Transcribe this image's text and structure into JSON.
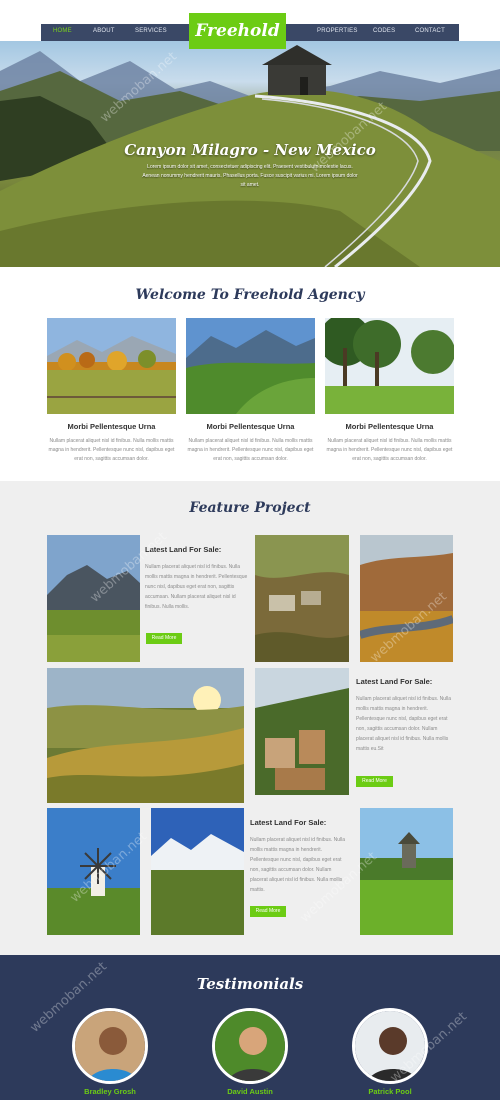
{
  "nav": {
    "left": [
      "HOME",
      "ABOUT",
      "SERVICES"
    ],
    "right": [
      "PROPERTIES",
      "CODES",
      "CONTACT"
    ],
    "logo": "Freehold",
    "colors": {
      "bar": "#3a4866",
      "accent": "#6ccc14"
    }
  },
  "hero": {
    "title": "Canyon Milagro - New Mexico",
    "text": "Lorem ipsum dolor sit amet, consectetuer adipiscing elit. Praesent vestibulum molestie lacus. Aenean nonummy hendrerit mauris. Phasellus porta. Fusce suscipit varius mi. Lorem ipsum dolor sit amet."
  },
  "welcome": {
    "title": "Welcome To Freehold Agency",
    "cards": [
      {
        "title": "Morbi Pellentesque Urna",
        "text": "Nullam placerat aliquet nisl id finibus. Nulla mollis mattis magna in hendrerit. Pellentesque nunc nisl, dapibus eget erat non, sagittis accumsan dolor."
      },
      {
        "title": "Morbi Pellentesque Urna",
        "text": "Nullam placerat aliquet nisl id finibus. Nulla mollis mattis magna in hendrerit. Pellentesque nunc nisl, dapibus eget erat non, sagittis accumsan dolor."
      },
      {
        "title": "Morbi Pellentesque Urna",
        "text": "Nullam placerat aliquet nisl id finibus. Nulla mollis mattis magna in hendrerit. Pellentesque nunc nisl, dapibus eget erat non, sagittis accumsan dolor."
      }
    ]
  },
  "feature": {
    "title": "Feature Project",
    "blocks": [
      {
        "title": "Latest Land For Sale:",
        "text": "Nullam placerat aliquet nisl id finibus. Nulla mollis mattis magna in hendrerit. Pellentesque nunc nisl, dapibus eget erat non, sagittis accumsan. Nullam placerat aliquet nisl id finibus. Nulla mollis.",
        "button": "Read More"
      },
      {
        "title": "Latest Land For Sale:",
        "text": "Nullam placerat aliquet nisl id finibus. Nulla mollis mattis magna in hendrerit. Pellentesque nunc nisl, dapibus eget erat non, sagittis accumsan dolor. Nullam placerat aliquet nisl id finibus. Nulla mollis mattis eu.Sit",
        "button": "Read More"
      },
      {
        "title": "Latest Land For Sale:",
        "text": "Nullam placerat aliquet nisl id finibus. Nulla mollis mattis magna in hendrerit. Pellentesque nunc nisl, dapibus eget erat non, sagittis accumsan dolor. Nullam placerat aliquet nisl id finibus. Nulla mollis mattis.",
        "button": "Read More"
      }
    ]
  },
  "testimonials": {
    "title": "Testimonials",
    "people": [
      "Bradley Grosh",
      "David Austin",
      "Patrick Pool"
    ]
  },
  "watermark": "webmoban.net"
}
